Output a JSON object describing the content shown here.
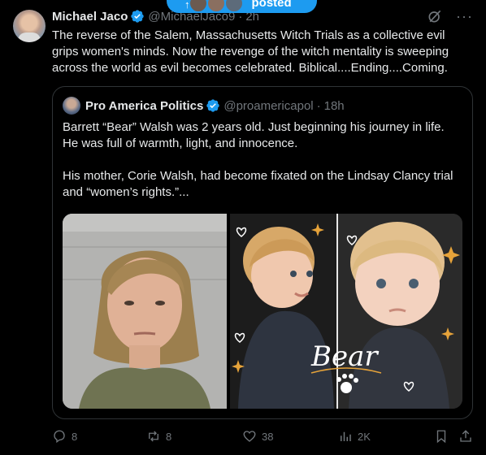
{
  "banner": {
    "label": "posted"
  },
  "tweet": {
    "author_name": "Michael Jaco",
    "handle": "@MichaelJaco9",
    "separator": "·",
    "time": "2h",
    "text": "The reverse of the Salem, Massachusetts Witch Trials as a collective evil grips women's minds. Now the revenge of the witch mentality is sweeping across the world as evil becomes celebrated. Biblical....Ending....Coming."
  },
  "quote": {
    "author_name": "Pro America Politics",
    "handle": "@proamericapol",
    "separator": "·",
    "time": "18h",
    "paragraph1": "Barrett “Bear” Walsh was 2 years old. Just beginning his journey in life. He was full of warmth, light, and innocence.",
    "paragraph2": "His mother, Corie Walsh, had become fixated on the Lindsay Clancy trial and “women’s rights.”...",
    "image_caption": "Bear"
  },
  "actions": {
    "replies": "8",
    "reposts": "8",
    "likes": "38",
    "views": "2K"
  },
  "colors": {
    "accent": "#1d9bf0",
    "background": "#000000",
    "text": "#e7e9ea",
    "muted": "#71767b",
    "border": "#2f3336"
  },
  "icons": {
    "verified": "verified-badge-icon",
    "grok": "grok-icon",
    "more": "more-icon",
    "reply": "reply-icon",
    "repost": "repost-icon",
    "like": "heart-icon",
    "views": "views-icon",
    "bookmark": "bookmark-icon",
    "share": "share-icon"
  }
}
